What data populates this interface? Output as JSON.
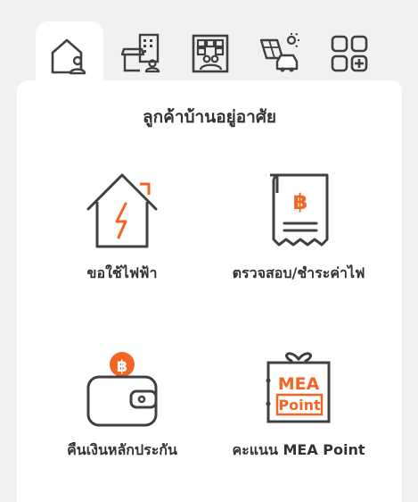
{
  "tabs": [
    {
      "icon": "house-person-icon",
      "active": true
    },
    {
      "icon": "shop-building-icon",
      "active": false
    },
    {
      "icon": "office-building-people-icon",
      "active": false
    },
    {
      "icon": "solar-ev-car-icon",
      "active": false
    },
    {
      "icon": "apps-grid-plus-icon",
      "active": false
    }
  ],
  "panel": {
    "title": "ลูกค้าบ้านอยู่อาศัย",
    "services": [
      {
        "label": "ขอใช้ไฟฟ้า",
        "icon": "house-lightning-icon"
      },
      {
        "label": "ตรวจสอบ/ชำระค่าไฟ",
        "icon": "baht-receipt-icon"
      },
      {
        "label": "คืนเงินหลักประกัน",
        "icon": "wallet-baht-icon"
      },
      {
        "label": "คะแนน MEA Point",
        "icon": "mea-point-gift-icon"
      }
    ],
    "mea_point_text": [
      "MEA",
      "Point"
    ]
  },
  "colors": {
    "accent": "#f26522",
    "icon_stroke": "#404040",
    "background": "#f1f1f1",
    "panel": "#ffffff"
  }
}
